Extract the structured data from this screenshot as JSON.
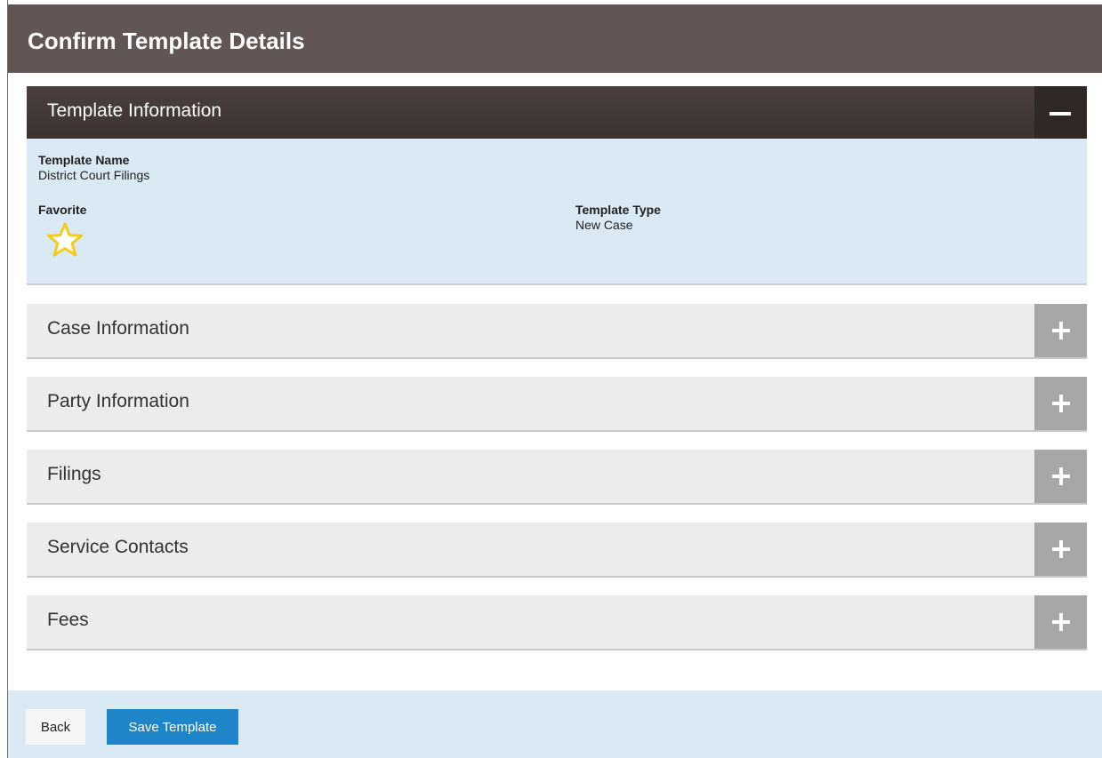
{
  "header": {
    "title": "Confirm Template Details"
  },
  "template_info": {
    "title": "Template Information",
    "toggle_icon": "minus-icon",
    "template_name_label": "Template Name",
    "template_name_value": "District Court Filings",
    "favorite_label": "Favorite",
    "favorite_icon": "star-icon",
    "template_type_label": "Template Type",
    "template_type_value": "New Case"
  },
  "sections": [
    {
      "title": "Case Information",
      "icon": "plus-icon"
    },
    {
      "title": "Party Information",
      "icon": "plus-icon"
    },
    {
      "title": "Filings",
      "icon": "plus-icon"
    },
    {
      "title": "Service Contacts",
      "icon": "plus-icon"
    },
    {
      "title": "Fees",
      "icon": "plus-icon"
    }
  ],
  "footer": {
    "back_label": "Back",
    "save_label": "Save Template"
  },
  "colors": {
    "header_bg": "#625654",
    "panel_head_bg": "#3c3230",
    "info_bg": "#daeaf5",
    "section_bg": "#ececec",
    "plus_bg": "#a7a7a7",
    "primary_button": "#1e86c8",
    "star": "#f5cc16"
  }
}
